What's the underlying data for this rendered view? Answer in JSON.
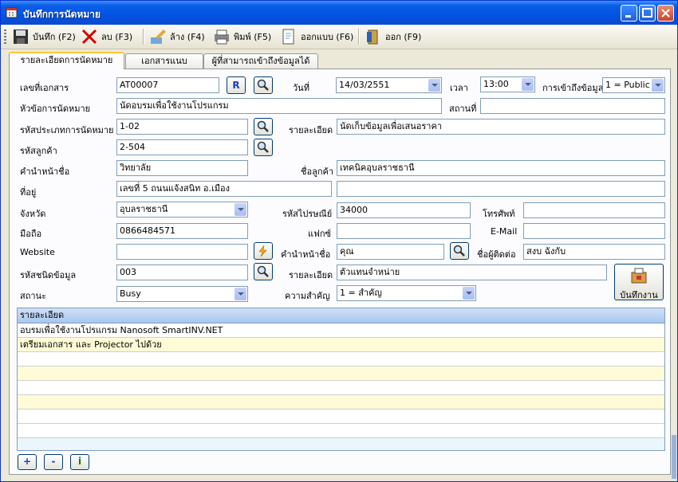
{
  "window": {
    "title": "บันทึกการนัดหมาย"
  },
  "toolbar": {
    "save": "บันทึก (F2)",
    "delete": "ลบ (F3)",
    "clear": "ล้าง (F4)",
    "print": "พิมพ์ (F5)",
    "design": "ออกแบบ (F6)",
    "exit": "ออก (F9)"
  },
  "tabs": [
    "รายละเอียดการนัดหมาย",
    "เอกสารแนบ",
    "ผู้ที่สามารถเข้าถึงข้อมูลได้"
  ],
  "form": {
    "doc_no_label": "เลขที่เอกสาร",
    "doc_no": "AT00007",
    "r_button": "R",
    "date_label": "วันที่",
    "date": "14/03/2551",
    "time_label": "เวลา",
    "time": "13:00",
    "access_label": "การเข้าถึงข้อมูล",
    "access": "1 = Public",
    "subject_label": "หัวข้อการนัดหมาย",
    "subject": "นัดอบรมเพื่อใช้งานโปรแกรม",
    "place_label": "สถานที่",
    "place": "",
    "type_code_label": "รหัสประเภทการนัดหมาย",
    "type_code": "1-02",
    "detail_label": "รายละเอียด",
    "detail": "นัดเก็บข้อมูลเพื่อเสนอราคา",
    "customer_code_label": "รหัสลูกค้า",
    "customer_code": "2-504",
    "prefix_label": "คำนำหน้าชื่อ",
    "prefix": "วิทยาลัย",
    "customer_name_label": "ชื่อลูกค้า",
    "customer_name": "เทคนิคอุบลราชธานี",
    "address_label": "ที่อยู่",
    "address1": "เลขที่ 5 ถนนแจ้งสนิท อ.เมือง",
    "address2": "",
    "province_label": "จังหวัด",
    "province": "อุบลราชธานี",
    "postcode_label": "รหัสไปรษณีย์",
    "postcode": "34000",
    "phone_label": "โทรศัพท์",
    "phone": "",
    "mobile_label": "มือถือ",
    "mobile": "0866484571",
    "fax_label": "แฟกซ์",
    "fax": "",
    "email_label": "E-Mail",
    "email": "",
    "website_label": "Website",
    "website": "",
    "contact_prefix_label": "คำนำหน้าชื่อ",
    "contact_prefix": "คุณ",
    "contact_name_label": "ชื่อผู้ติดต่อ",
    "contact_name": "สงบ ฉังกับ",
    "info_code_label": "รหัสชนิดข้อมูล",
    "info_code": "003",
    "detail2_label": "รายละเอียด",
    "detail2": "ตัวแทนจำหน่าย",
    "status_label": "สถานะ",
    "status": "Busy",
    "priority_label": "ความสำคัญ",
    "priority": "1 = สำคัญ",
    "save_task": "บันทึกงาน"
  },
  "grid": {
    "header": "รายละเอียด",
    "rows": [
      "อบรมเพื่อใช้งานโปรแกรม Nanosoft SmartINV.NET",
      "เตรียมเอกสาร และ Projector ไปด้วย",
      "",
      "",
      "",
      "",
      "",
      "",
      ""
    ]
  },
  "nav": {
    "add": "+",
    "remove": "-",
    "info": "i"
  }
}
